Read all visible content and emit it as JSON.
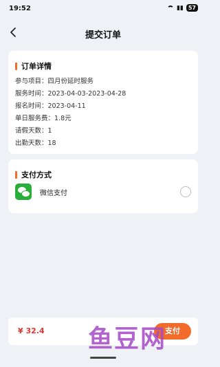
{
  "status_bar": {
    "time": "19:52",
    "battery": "57"
  },
  "nav": {
    "title": "提交订单"
  },
  "order": {
    "section_title": "订单详情",
    "rows": [
      "参与项目：四月份延时服务",
      "服务时间：2023-04-03-2023-04-28",
      "报名时间：2023-04-11",
      "单日服务费：1.8元",
      "请假天数：1",
      "出勤天数：18"
    ]
  },
  "payment": {
    "section_title": "支付方式",
    "method_label": "微信支付",
    "selected": false
  },
  "footer": {
    "price": "¥ 32.4",
    "pay_button": "支付"
  },
  "watermark": "鱼豆网",
  "colors": {
    "accent": "#f26b2a",
    "price": "#e8352e",
    "wechat": "#2aae3a"
  }
}
